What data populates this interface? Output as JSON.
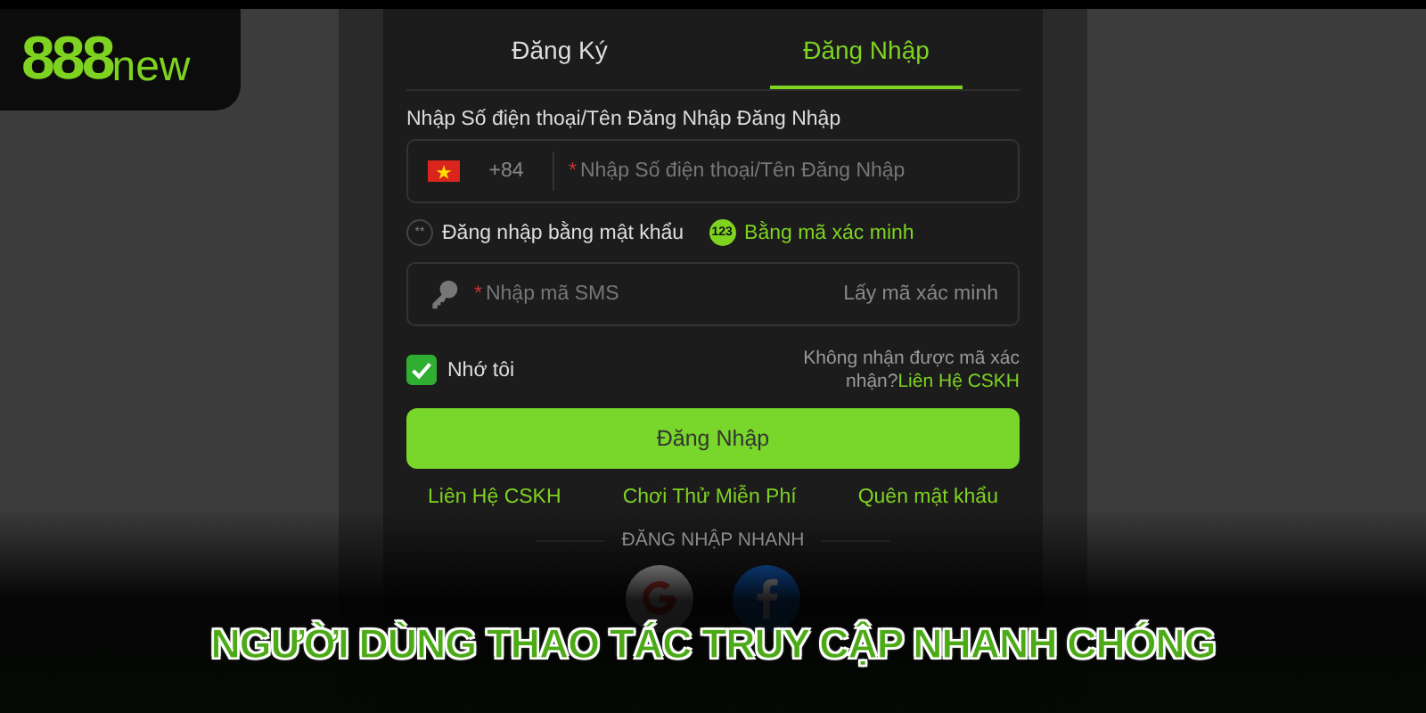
{
  "logo": {
    "digits": "888",
    "word": "new"
  },
  "tabs": [
    {
      "label": "Đăng Ký",
      "selected": false
    },
    {
      "label": "Đăng Nhập",
      "selected": true
    }
  ],
  "account_label": "Nhập Số điện thoại/Tên Đăng Nhập Đăng Nhập",
  "phone_field": {
    "country_code": "+84",
    "placeholder": "Nhập Số điện thoại/Tên Đăng Nhập",
    "required_mark": "*"
  },
  "login_methods": [
    {
      "badge": "**",
      "label": "Đăng nhập bằng mật khẩu",
      "selected": false
    },
    {
      "badge": "123",
      "label": "Bằng mã xác minh",
      "selected": true
    }
  ],
  "sms_field": {
    "placeholder": "Nhập mã SMS",
    "required_mark": "*",
    "action": "Lấy mã xác minh"
  },
  "remember": {
    "label": "Nhớ tôi",
    "checked": true
  },
  "help": {
    "text": "Không nhận được mã xác nhận?",
    "link": "Liên Hệ CSKH"
  },
  "submit": "Đăng Nhập",
  "links": [
    "Liên Hệ CSKH",
    "Chơi Thử Miễn Phí",
    "Quên mật khẩu"
  ],
  "quick_login": {
    "title": "ĐĂNG NHẬP NHANH",
    "providers": [
      {
        "kind": "google"
      },
      {
        "kind": "facebook"
      }
    ]
  },
  "caption": "NGƯỜI DÙNG THAO TÁC TRUY CẬP NHANH CHÓNG"
}
